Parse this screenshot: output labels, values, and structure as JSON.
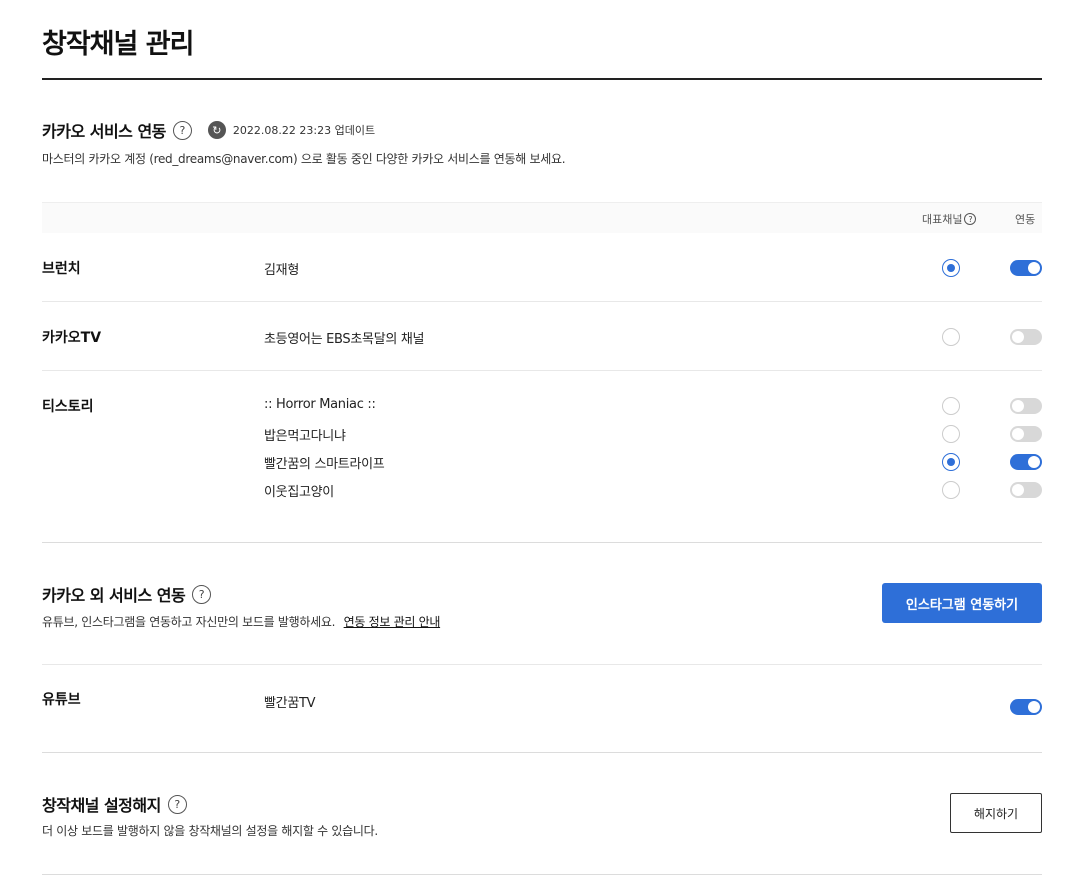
{
  "page": {
    "title": "창작채널 관리"
  },
  "kakao_services": {
    "title": "카카오 서비스 연동",
    "help": "?",
    "update_text": "2022.08.22 23:23 업데이트",
    "description": "마스터의 카카오 계정 (red_dreams@naver.com) 으로 활동 중인 다양한 카카오 서비스를 연동해 보세요.",
    "columns": {
      "primary": "대표채널",
      "link": "연동"
    },
    "rows": [
      {
        "name": "브런치",
        "items": [
          {
            "label": "김재형",
            "primary": true,
            "linked": true
          }
        ]
      },
      {
        "name": "카카오TV",
        "items": [
          {
            "label": "초등영어는 EBS초목달의 채널",
            "primary": false,
            "linked": false
          }
        ]
      },
      {
        "name": "티스토리",
        "items": [
          {
            "label": ":: Horror Maniac ::",
            "primary": false,
            "linked": false
          },
          {
            "label": "밥은먹고다니냐",
            "primary": false,
            "linked": false
          },
          {
            "label": "빨간꿈의 스마트라이프",
            "primary": true,
            "linked": true
          },
          {
            "label": "이웃집고양이",
            "primary": false,
            "linked": false
          }
        ]
      }
    ]
  },
  "external_services": {
    "title": "카카오 외 서비스 연동",
    "help": "?",
    "description": "유튜브, 인스타그램을 연동하고 자신만의 보드를 발행하세요.",
    "link_text": "연동 정보 관리 안내",
    "instagram_button": "인스타그램 연동하기",
    "rows": [
      {
        "name": "유튜브",
        "items": [
          {
            "label": "빨간꿈TV",
            "linked": true
          }
        ]
      }
    ]
  },
  "unset": {
    "title": "창작채널 설정해지",
    "help": "?",
    "description": "더 이상 보드를 발행하지 않을 창작채널의 설정을 해지할 수 있습니다.",
    "button": "해지하기"
  },
  "colors": {
    "accent": "#2e6fd8",
    "toggle_off": "#d8d8d8"
  }
}
